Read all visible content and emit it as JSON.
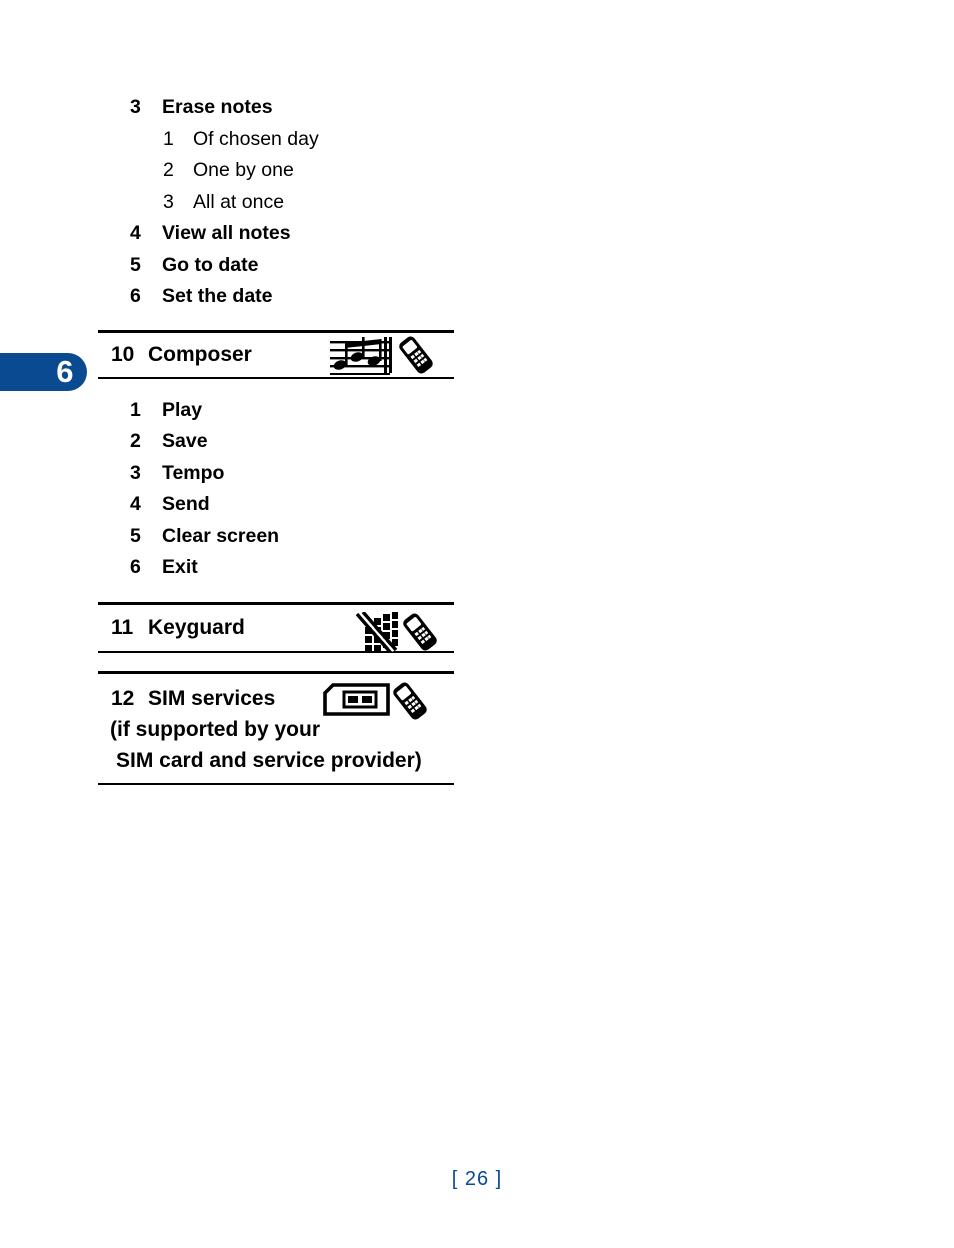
{
  "chapter_tab": {
    "number": "6",
    "color": "#0a4a90"
  },
  "top_list": {
    "items": [
      {
        "num": "3",
        "label": "Erase notes",
        "level": 1
      },
      {
        "num": "1",
        "label": "Of chosen day",
        "level": 2
      },
      {
        "num": "2",
        "label": "One by one",
        "level": 2
      },
      {
        "num": "3",
        "label": "All at once",
        "level": 2
      },
      {
        "num": "4",
        "label": "View all notes",
        "level": 1
      },
      {
        "num": "5",
        "label": "Go to date",
        "level": 1
      },
      {
        "num": "6",
        "label": "Set the date",
        "level": 1
      }
    ]
  },
  "sections": [
    {
      "num": "10",
      "title": "Composer",
      "icons": [
        "music-staff-icon",
        "phone-icon"
      ],
      "items": [
        {
          "num": "1",
          "label": "Play"
        },
        {
          "num": "2",
          "label": "Save"
        },
        {
          "num": "3",
          "label": "Tempo"
        },
        {
          "num": "4",
          "label": "Send"
        },
        {
          "num": "5",
          "label": "Clear screen"
        },
        {
          "num": "6",
          "label": "Exit"
        }
      ]
    },
    {
      "num": "11",
      "title": "Keyguard",
      "icons": [
        "keypad-locked-icon",
        "phone-icon"
      ],
      "items": []
    },
    {
      "num": "12",
      "title": "SIM services",
      "title_line2": "(if supported by your",
      "title_line3": "SIM card and service provider)",
      "icons": [
        "sim-card-icon",
        "phone-icon"
      ],
      "items": []
    }
  ],
  "footer": {
    "page": "[ 26 ]"
  }
}
